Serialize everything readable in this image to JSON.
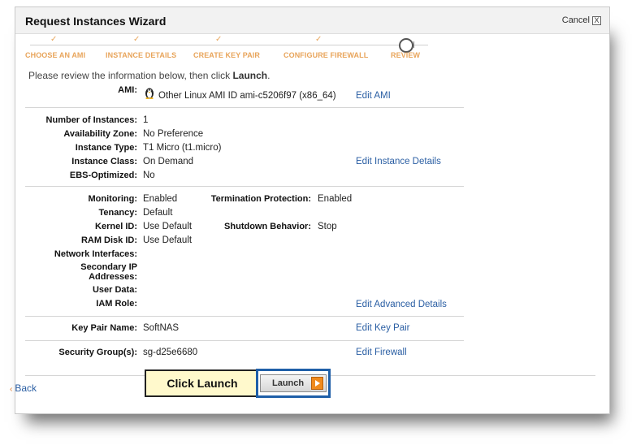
{
  "window": {
    "title": "Request Instances Wizard",
    "cancel_label": "Cancel",
    "close_glyph": "X"
  },
  "steps": {
    "check_glyph": "✓",
    "items": [
      {
        "label": "CHOOSE AN AMI",
        "state": "done"
      },
      {
        "label": "INSTANCE DETAILS",
        "state": "done"
      },
      {
        "label": "CREATE KEY PAIR",
        "state": "done"
      },
      {
        "label": "CONFIGURE FIREWALL",
        "state": "done"
      },
      {
        "label": "REVIEW",
        "state": "current"
      }
    ]
  },
  "intro": {
    "prefix": "Please review the information below, then click ",
    "emph": "Launch",
    "suffix": "."
  },
  "ami": {
    "label": "AMI:",
    "value": "Other Linux AMI ID ami-c5206f97 (x86_64)",
    "edit": "Edit AMI",
    "icon": "penguin-icon"
  },
  "instance": {
    "fields": [
      {
        "label": "Number of Instances:",
        "value": "1"
      },
      {
        "label": "Availability Zone:",
        "value": "No Preference"
      },
      {
        "label": "Instance Type:",
        "value": "T1 Micro (t1.micro)"
      },
      {
        "label": "Instance Class:",
        "value": "On Demand"
      },
      {
        "label": "EBS-Optimized:",
        "value": "No"
      }
    ],
    "edit": "Edit Instance Details"
  },
  "advanced": {
    "left": [
      {
        "label": "Monitoring:",
        "value": "Enabled"
      },
      {
        "label": "Tenancy:",
        "value": "Default"
      },
      {
        "label": "Kernel ID:",
        "value": "Use Default"
      },
      {
        "label": "RAM Disk ID:",
        "value": "Use Default"
      },
      {
        "label": "Network Interfaces:",
        "value": ""
      },
      {
        "label": "Secondary IP Addresses:",
        "value": ""
      },
      {
        "label": "User Data:",
        "value": ""
      },
      {
        "label": "IAM Role:",
        "value": ""
      }
    ],
    "right": [
      {
        "label": "Termination Protection:",
        "value": "Enabled"
      },
      {
        "label": "Shutdown Behavior:",
        "value": "Stop"
      }
    ],
    "edit": "Edit Advanced Details"
  },
  "keypair": {
    "label": "Key Pair Name:",
    "value": "SoftNAS",
    "edit": "Edit Key Pair"
  },
  "security": {
    "label": "Security Group(s):",
    "value": "sg-d25e6680",
    "edit": "Edit Firewall"
  },
  "footer": {
    "back_label": "Back",
    "callout_label": "Click Launch",
    "launch_label": "Launch"
  },
  "colors": {
    "link": "#2a5ea3",
    "step_accent": "#e8a45a",
    "launch_highlight": "#1f5fa8",
    "callout_bg": "#fff9cc"
  }
}
